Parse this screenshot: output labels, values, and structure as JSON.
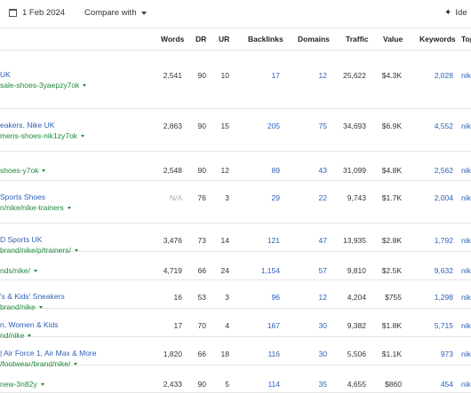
{
  "toolbar": {
    "date": "1 Feb 2024",
    "compare": "Compare with",
    "ideas": "Ide"
  },
  "columns": {
    "words": "Words",
    "dr": "DR",
    "ur": "UR",
    "backlinks": "Backlinks",
    "domains": "Domains",
    "traffic": "Traffic",
    "value": "Value",
    "keywords": "Keywords",
    "top": "Top"
  },
  "rows": [
    {
      "title": "UK",
      "url": "sale-shoes-3yaepzy7ok",
      "words": "2,541",
      "dr": "90",
      "ur": "10",
      "backlinks": "17",
      "domains": "12",
      "traffic": "25,622",
      "value": "$4.3K",
      "keywords": "2,028",
      "topic": "nike"
    },
    {
      "title": "eakers. Nike UK",
      "url": "mens-shoes-nik1zy7ok",
      "words": "2,863",
      "dr": "90",
      "ur": "15",
      "backlinks": "205",
      "domains": "75",
      "traffic": "34,693",
      "value": "$6.9K",
      "keywords": "4,552",
      "topic": "nike"
    },
    {
      "title": "",
      "url": "shoes-y7ok",
      "words": "2,548",
      "dr": "90",
      "ur": "12",
      "backlinks": "89",
      "domains": "43",
      "traffic": "31,099",
      "value": "$4.8K",
      "keywords": "2,562",
      "topic": "nike"
    },
    {
      "title": "Sports Shoes",
      "url": "n/nike/nike-trainers",
      "words": "N/A",
      "dr": "76",
      "ur": "3",
      "backlinks": "29",
      "domains": "22",
      "traffic": "9,743",
      "value": "$1.7K",
      "keywords": "2,004",
      "topic": "nike"
    },
    {
      "title": "D Sports UK",
      "url": "brand/nike/p/trainers/",
      "words": "3,476",
      "dr": "73",
      "ur": "14",
      "backlinks": "121",
      "domains": "47",
      "traffic": "13,935",
      "value": "$2.8K",
      "keywords": "1,792",
      "topic": "nike"
    },
    {
      "title": "",
      "url": "nds/nike/",
      "words": "4,719",
      "dr": "66",
      "ur": "24",
      "backlinks": "1,154",
      "domains": "57",
      "traffic": "9,810",
      "value": "$2.5K",
      "keywords": "9,632",
      "topic": "nike"
    },
    {
      "title": "'s & Kids' Sneakers",
      "url": "brand/nike",
      "words": "16",
      "dr": "53",
      "ur": "3",
      "backlinks": "96",
      "domains": "12",
      "traffic": "4,204",
      "value": "$755",
      "keywords": "1,298",
      "topic": "nike"
    },
    {
      "title": "n, Women & Kids",
      "url": "nd/nike",
      "words": "17",
      "dr": "70",
      "ur": "4",
      "backlinks": "167",
      "domains": "30",
      "traffic": "9,382",
      "value": "$1.8K",
      "keywords": "5,715",
      "topic": "nike"
    },
    {
      "title": "| Air Force 1, Air Max & More",
      "url": "/footwear/brand/nike/",
      "words": "1,820",
      "dr": "66",
      "ur": "18",
      "backlinks": "116",
      "domains": "30",
      "traffic": "5,506",
      "value": "$1.1K",
      "keywords": "973",
      "topic": "nike"
    },
    {
      "title": "",
      "url": "new-3n82y",
      "words": "2,433",
      "dr": "90",
      "ur": "5",
      "backlinks": "114",
      "domains": "35",
      "traffic": "4,655",
      "value": "$860",
      "keywords": "454",
      "topic": "nike"
    }
  ]
}
